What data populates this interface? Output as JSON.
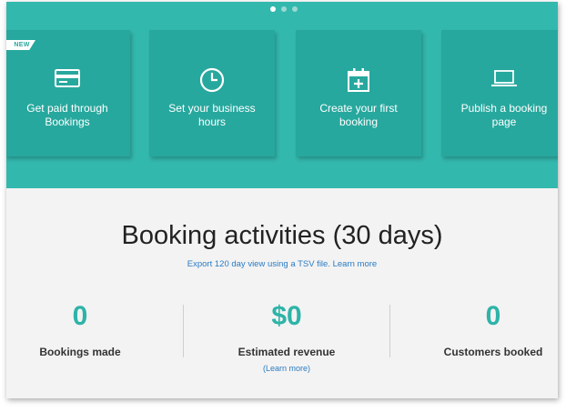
{
  "carousel": {
    "page_count": 3,
    "active_index": 0
  },
  "cards": [
    {
      "label": "Get paid through Bookings",
      "badge": "NEW",
      "icon": "credit-card-icon"
    },
    {
      "label": "Set your business hours",
      "icon": "clock-icon"
    },
    {
      "label": "Create your first booking",
      "icon": "calendar-add-icon"
    },
    {
      "label": "Publish a booking page",
      "icon": "laptop-icon"
    }
  ],
  "activities": {
    "title": "Booking activities (30 days)",
    "export_text": "Export 120 day view using a TSV file.",
    "export_link": "Learn more",
    "stats": [
      {
        "value": "0",
        "caption": "Bookings made"
      },
      {
        "value": "$0",
        "caption": "Estimated revenue",
        "link": "(Learn more)"
      },
      {
        "value": "0",
        "caption": "Customers booked"
      }
    ]
  },
  "colors": {
    "banner": "#33b8ae",
    "card": "#27a89e",
    "accent_number": "#2eb3a8",
    "link": "#2a7bc3",
    "panel_bg": "#f3f3f3"
  }
}
